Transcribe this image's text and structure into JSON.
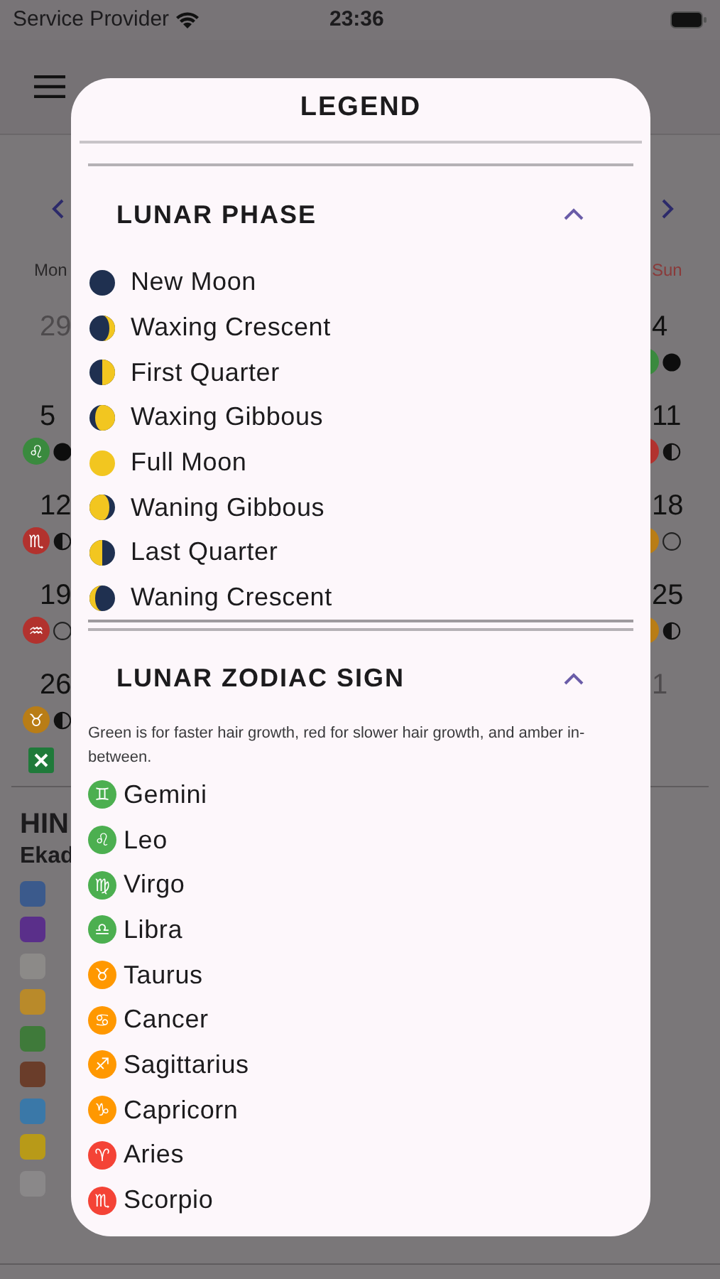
{
  "status_bar": {
    "carrier": "Service Provider",
    "time": "23:36"
  },
  "calendar": {
    "columns": [
      {
        "label": "Mon",
        "weekend": false,
        "days": [
          {
            "day": "29",
            "muted": true
          },
          {
            "day": "5",
            "muted": false,
            "sign": {
              "glyph": "♌",
              "color": "#3a8a3e"
            },
            "moon": {
              "kind": "new"
            }
          },
          {
            "day": "12",
            "muted": false,
            "sign": {
              "glyph": "♏",
              "color": "#b2322e"
            },
            "moon": {
              "kind": "quarter"
            }
          },
          {
            "day": "19",
            "muted": false,
            "sign": {
              "glyph": "♒",
              "color": "#b2322e"
            },
            "moon": {
              "kind": "full"
            }
          },
          {
            "day": "26",
            "muted": false,
            "sign": {
              "glyph": "♉",
              "color": "#b97d16"
            },
            "moon": {
              "kind": "quarter"
            }
          }
        ]
      },
      {
        "label": "Sun",
        "weekend": true,
        "days": [
          {
            "day": "4",
            "muted": false,
            "sign": {
              "color": "#3a8a3e"
            },
            "moon": {
              "kind": "new"
            }
          },
          {
            "day": "11",
            "muted": false,
            "sign": {
              "color": "#b2322e"
            },
            "moon": {
              "kind": "quarter"
            }
          },
          {
            "day": "18",
            "muted": false,
            "sign": {
              "color": "#b97d16"
            },
            "moon": {
              "kind": "full"
            }
          },
          {
            "day": "25",
            "muted": false,
            "sign": {
              "color": "#b97d16"
            },
            "moon": {
              "kind": "quarter"
            }
          },
          {
            "day": "1",
            "muted": true
          }
        ]
      }
    ]
  },
  "hints": {
    "title": "HIN",
    "subtitle": "Ekad",
    "items": [
      {
        "kind": "hands"
      },
      {
        "kind": "om"
      },
      {
        "kind": "cutlery"
      },
      {
        "kind": "person"
      },
      {
        "kind": "sprout"
      },
      {
        "kind": "books"
      },
      {
        "kind": "gem"
      },
      {
        "kind": "flower"
      },
      {
        "kind": "blank"
      }
    ]
  },
  "legend": {
    "title": "LEGEND",
    "sections": [
      {
        "kind": "phases",
        "title": "LUNAR PHASE",
        "expanded": true,
        "items": [
          {
            "kind": "new",
            "label": "New Moon"
          },
          {
            "kind": "waxcrescent",
            "label": "Waxing Crescent"
          },
          {
            "kind": "firstquarter",
            "label": "First Quarter"
          },
          {
            "kind": "waxgibbous",
            "label": "Waxing Gibbous"
          },
          {
            "kind": "full",
            "label": "Full Moon"
          },
          {
            "kind": "wangibbous",
            "label": "Waning Gibbous"
          },
          {
            "kind": "lastquarter",
            "label": "Last Quarter"
          },
          {
            "kind": "wancrescent",
            "label": "Waning Crescent"
          }
        ]
      },
      {
        "kind": "signs",
        "title": "LUNAR ZODIAC SIGN",
        "expanded": true,
        "note": "Green is for faster hair growth, red for slower hair growth, and amber in-between.",
        "items": [
          {
            "glyph": "♊",
            "label": "Gemini",
            "color": "#4caf50"
          },
          {
            "glyph": "♌",
            "label": "Leo",
            "color": "#4caf50"
          },
          {
            "glyph": "♍",
            "label": "Virgo",
            "color": "#4caf50"
          },
          {
            "glyph": "♎",
            "label": "Libra",
            "color": "#4caf50"
          },
          {
            "glyph": "♉",
            "label": "Taurus",
            "color": "#ff9800"
          },
          {
            "glyph": "♋",
            "label": "Cancer",
            "color": "#ff9800"
          },
          {
            "glyph": "♐",
            "label": "Sagittarius",
            "color": "#ff9800"
          },
          {
            "glyph": "♑",
            "label": "Capricorn",
            "color": "#ff9800"
          },
          {
            "glyph": "♈",
            "label": "Aries",
            "color": "#f44336"
          },
          {
            "glyph": "♏",
            "label": "Scorpio",
            "color": "#f44336"
          }
        ]
      }
    ]
  }
}
